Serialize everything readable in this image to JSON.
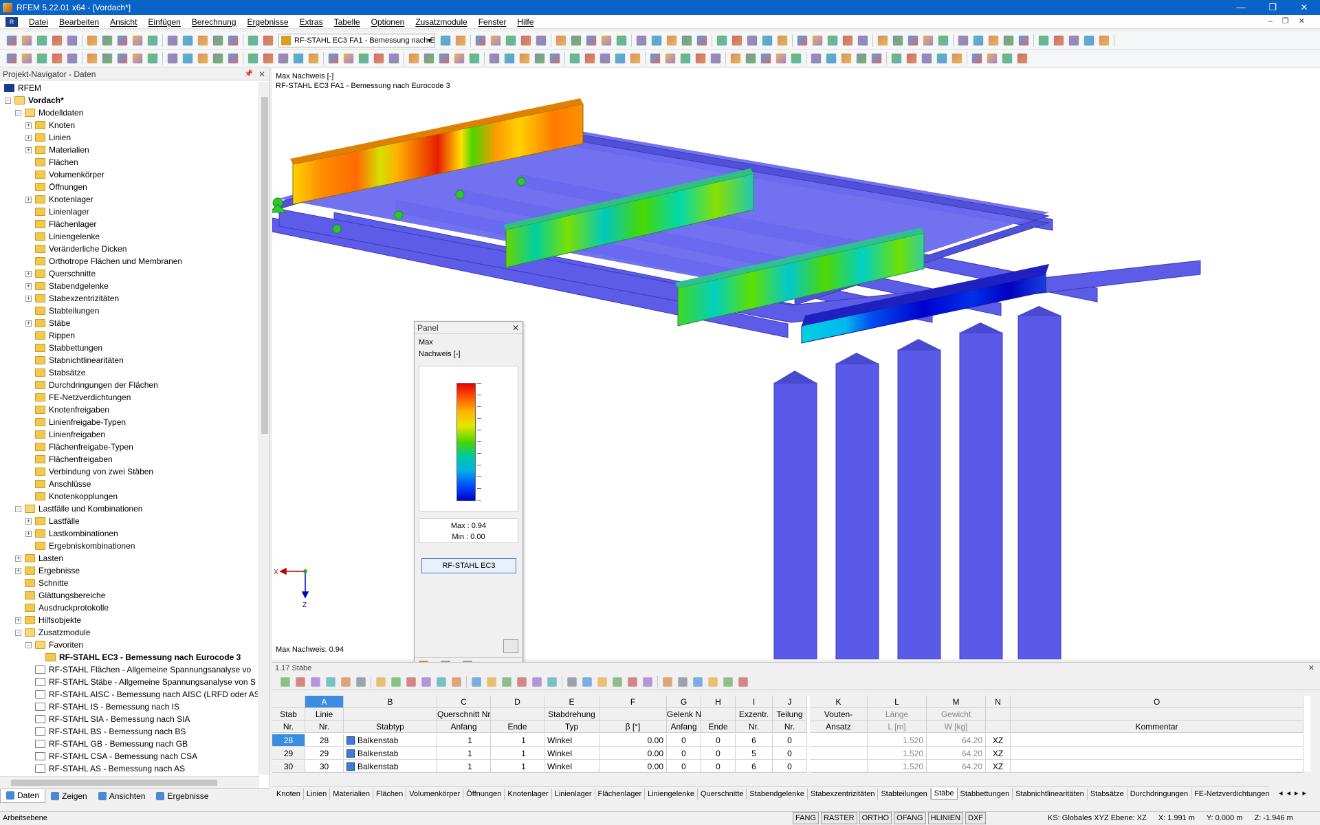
{
  "window": {
    "title": "RFEM 5.22.01 x64 - [Vordach*]"
  },
  "menu": [
    "Datei",
    "Bearbeiten",
    "Ansicht",
    "Einfügen",
    "Berechnung",
    "Ergebnisse",
    "Extras",
    "Tabelle",
    "Optionen",
    "Zusatzmodule",
    "Fenster",
    "Hilfe"
  ],
  "toolbar": {
    "combo": "RF-STAHL EC3 FA1 - Bemessung nach E"
  },
  "navigator": {
    "title": "Projekt-Navigator - Daten",
    "items": [
      {
        "label": "RFEM",
        "level": 0,
        "exp": "",
        "bold": false
      },
      {
        "label": "Vordach*",
        "level": 1,
        "exp": "-",
        "bold": true
      },
      {
        "label": "Modelldaten",
        "level": 2,
        "exp": "-",
        "bold": false
      },
      {
        "label": "Knoten",
        "level": 3,
        "exp": "+",
        "bold": false
      },
      {
        "label": "Linien",
        "level": 3,
        "exp": "+",
        "bold": false
      },
      {
        "label": "Materialien",
        "level": 3,
        "exp": "+",
        "bold": false
      },
      {
        "label": "Flächen",
        "level": 3,
        "exp": "",
        "bold": false
      },
      {
        "label": "Volumenkörper",
        "level": 3,
        "exp": "",
        "bold": false
      },
      {
        "label": "Öffnungen",
        "level": 3,
        "exp": "",
        "bold": false
      },
      {
        "label": "Knotenlager",
        "level": 3,
        "exp": "+",
        "bold": false
      },
      {
        "label": "Linienlager",
        "level": 3,
        "exp": "",
        "bold": false
      },
      {
        "label": "Flächenlager",
        "level": 3,
        "exp": "",
        "bold": false
      },
      {
        "label": "Liniengelenke",
        "level": 3,
        "exp": "",
        "bold": false
      },
      {
        "label": "Veränderliche Dicken",
        "level": 3,
        "exp": "",
        "bold": false
      },
      {
        "label": "Orthotrope Flächen und Membranen",
        "level": 3,
        "exp": "",
        "bold": false
      },
      {
        "label": "Querschnitte",
        "level": 3,
        "exp": "+",
        "bold": false
      },
      {
        "label": "Stabendgelenke",
        "level": 3,
        "exp": "+",
        "bold": false
      },
      {
        "label": "Stabexzentrizitäten",
        "level": 3,
        "exp": "+",
        "bold": false
      },
      {
        "label": "Stabteilungen",
        "level": 3,
        "exp": "",
        "bold": false
      },
      {
        "label": "Stäbe",
        "level": 3,
        "exp": "+",
        "bold": false
      },
      {
        "label": "Rippen",
        "level": 3,
        "exp": "",
        "bold": false
      },
      {
        "label": "Stabbettungen",
        "level": 3,
        "exp": "",
        "bold": false
      },
      {
        "label": "Stabnichtlinearitäten",
        "level": 3,
        "exp": "",
        "bold": false
      },
      {
        "label": "Stabsätze",
        "level": 3,
        "exp": "",
        "bold": false
      },
      {
        "label": "Durchdringungen der Flächen",
        "level": 3,
        "exp": "",
        "bold": false
      },
      {
        "label": "FE-Netzverdichtungen",
        "level": 3,
        "exp": "",
        "bold": false
      },
      {
        "label": "Knotenfreigaben",
        "level": 3,
        "exp": "",
        "bold": false
      },
      {
        "label": "Linienfreigabe-Typen",
        "level": 3,
        "exp": "",
        "bold": false
      },
      {
        "label": "Linienfreigaben",
        "level": 3,
        "exp": "",
        "bold": false
      },
      {
        "label": "Flächenfreigabe-Typen",
        "level": 3,
        "exp": "",
        "bold": false
      },
      {
        "label": "Flächenfreigaben",
        "level": 3,
        "exp": "",
        "bold": false
      },
      {
        "label": "Verbindung von zwei Stäben",
        "level": 3,
        "exp": "",
        "bold": false
      },
      {
        "label": "Anschlüsse",
        "level": 3,
        "exp": "",
        "bold": false
      },
      {
        "label": "Knotenkopplungen",
        "level": 3,
        "exp": "",
        "bold": false
      },
      {
        "label": "Lastfälle und Kombinationen",
        "level": 2,
        "exp": "-",
        "bold": false
      },
      {
        "label": "Lastfälle",
        "level": 3,
        "exp": "+",
        "bold": false
      },
      {
        "label": "Lastkombinationen",
        "level": 3,
        "exp": "+",
        "bold": false
      },
      {
        "label": "Ergebniskombinationen",
        "level": 3,
        "exp": "",
        "bold": false
      },
      {
        "label": "Lasten",
        "level": 2,
        "exp": "+",
        "bold": false
      },
      {
        "label": "Ergebnisse",
        "level": 2,
        "exp": "+",
        "bold": false
      },
      {
        "label": "Schnitte",
        "level": 2,
        "exp": "",
        "bold": false
      },
      {
        "label": "Glättungsbereiche",
        "level": 2,
        "exp": "",
        "bold": false
      },
      {
        "label": "Ausdruckprotokolle",
        "level": 2,
        "exp": "",
        "bold": false
      },
      {
        "label": "Hilfsobjekte",
        "level": 2,
        "exp": "+",
        "bold": false
      },
      {
        "label": "Zusatzmodule",
        "level": 2,
        "exp": "-",
        "bold": false
      },
      {
        "label": "Favoriten",
        "level": 3,
        "exp": "-",
        "bold": false
      },
      {
        "label": "RF-STAHL EC3 - Bemessung nach Eurocode 3",
        "level": 4,
        "exp": "",
        "bold": true
      },
      {
        "label": "RF-STAHL Flächen - Allgemeine Spannungsanalyse vo",
        "level": 3,
        "exp": "",
        "bold": false
      },
      {
        "label": "RF-STAHL Stäbe - Allgemeine Spannungsanalyse von S",
        "level": 3,
        "exp": "",
        "bold": false
      },
      {
        "label": "RF-STAHL AISC - Bemessung nach AISC (LRFD oder AS",
        "level": 3,
        "exp": "",
        "bold": false
      },
      {
        "label": "RF-STAHL IS - Bemessung nach IS",
        "level": 3,
        "exp": "",
        "bold": false
      },
      {
        "label": "RF-STAHL SIA - Bemessung nach SIA",
        "level": 3,
        "exp": "",
        "bold": false
      },
      {
        "label": "RF-STAHL BS - Bemessung nach BS",
        "level": 3,
        "exp": "",
        "bold": false
      },
      {
        "label": "RF-STAHL GB - Bemessung nach GB",
        "level": 3,
        "exp": "",
        "bold": false
      },
      {
        "label": "RF-STAHL CSA - Bemessung nach CSA",
        "level": 3,
        "exp": "",
        "bold": false
      },
      {
        "label": "RF-STAHL AS - Bemessung nach AS",
        "level": 3,
        "exp": "",
        "bold": false
      }
    ],
    "tabs": [
      "Daten",
      "Zeigen",
      "Ansichten",
      "Ergebnisse"
    ]
  },
  "viewport": {
    "line1": "Max Nachweis [-]",
    "line2": "RF-STAHL EC3 FA1 - Bemessung nach Eurocode 3",
    "footer": "Max Nachweis: 0.94",
    "axis_x": "X",
    "axis_z": "Z"
  },
  "panel": {
    "title": "Panel",
    "label1": "Max",
    "label2": "Nachweis [-]",
    "max": "Max  :  0.94",
    "min": "Min  :  0.00",
    "button": "RF-STAHL EC3"
  },
  "table": {
    "title": "1.17 Stäbe",
    "letters": [
      "A",
      "B",
      "C",
      "D",
      "E",
      "F",
      "G",
      "H",
      "I",
      "J",
      "K",
      "L",
      "M",
      "N",
      "O"
    ],
    "head1": [
      "Stab",
      "Linie",
      "",
      "Querschnitt Nr.",
      "",
      "Stabdrehung",
      "",
      "Gelenk Nr.",
      "",
      "Exzentr.",
      "Teilung",
      "Vouten-",
      "Länge",
      "Gewicht",
      "",
      ""
    ],
    "head2": [
      "Nr.",
      "Nr.",
      "Stabtyp",
      "Anfang",
      "Ende",
      "Typ",
      "β [°]",
      "Anfang",
      "Ende",
      "Nr.",
      "Nr.",
      "Ansatz",
      "L [m]",
      "W [kg]",
      "",
      "Kommentar"
    ],
    "rows": [
      [
        "28",
        "28",
        "Balkenstab",
        "1",
        "1",
        "Winkel",
        "0.00",
        "0",
        "0",
        "6",
        "0",
        "",
        "1.520",
        "64.20",
        "XZ",
        ""
      ],
      [
        "29",
        "29",
        "Balkenstab",
        "1",
        "1",
        "Winkel",
        "0.00",
        "0",
        "0",
        "5",
        "0",
        "",
        "1.520",
        "64.20",
        "XZ",
        ""
      ],
      [
        "30",
        "30",
        "Balkenstab",
        "1",
        "1",
        "Winkel",
        "0.00",
        "0",
        "0",
        "6",
        "0",
        "",
        "1.520",
        "64.20",
        "XZ",
        ""
      ]
    ]
  },
  "bottom_tabs": [
    "Knoten",
    "Linien",
    "Materialien",
    "Flächen",
    "Volumenkörper",
    "Öffnungen",
    "Knotenlager",
    "Linienlager",
    "Flächenlager",
    "Liniengelenke",
    "Querschnitte",
    "Stabendgelenke",
    "Stabexzentrizitäten",
    "Stabteilungen",
    "Stäbe",
    "Stabbettungen",
    "Stabnichtlinearitäten",
    "Stabsätze",
    "Durchdringungen",
    "FE-Netzverdichtungen"
  ],
  "active_bottom_tab": "Stäbe",
  "status": {
    "left": "Arbeitsebene",
    "buttons": [
      "FANG",
      "RASTER",
      "ORTHO",
      "OFANG",
      "HLINIEN",
      "DXF"
    ],
    "ks": "KS: Globales XYZ  Ebene: XZ",
    "x": "X:  1.991 m",
    "y": "Y:  0.000 m",
    "z": "Z:  -1.946 m"
  },
  "colors": {
    "beam": "#5a5ae6",
    "title": "#0a64c8",
    "support": "#2ec82e"
  }
}
